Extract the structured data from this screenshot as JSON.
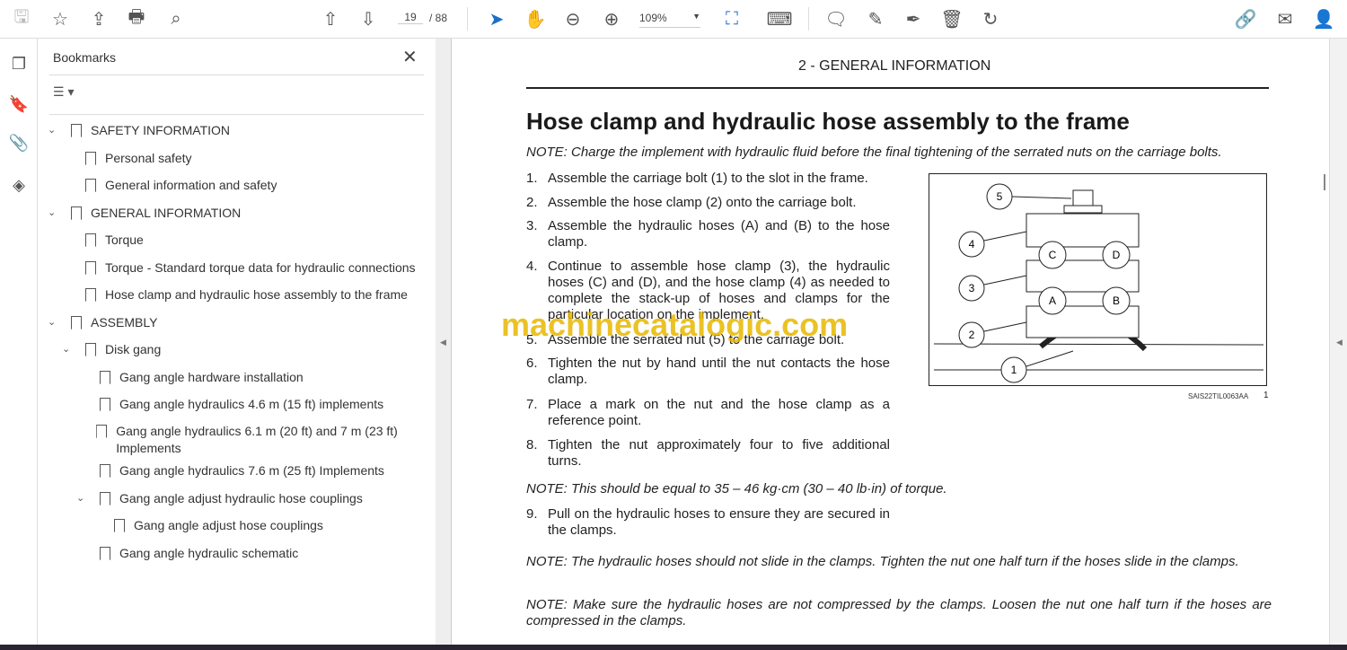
{
  "toolbar": {
    "page_current": "19",
    "page_total": "/ 88",
    "zoom": "109%"
  },
  "sidebar": {
    "title": "Bookmarks",
    "items": [
      {
        "label": "SAFETY INFORMATION",
        "level": 0,
        "expanded": true
      },
      {
        "label": "Personal safety",
        "level": 1
      },
      {
        "label": "General information and safety",
        "level": 1
      },
      {
        "label": "GENERAL INFORMATION",
        "level": 0,
        "expanded": true
      },
      {
        "label": "Torque",
        "level": 1
      },
      {
        "label": "Torque - Standard torque data for hydraulic connections",
        "level": 1
      },
      {
        "label": "Hose clamp and hydraulic hose assembly to the frame",
        "level": 1
      },
      {
        "label": "ASSEMBLY",
        "level": 0,
        "expanded": true
      },
      {
        "label": "Disk gang",
        "level": 1,
        "expanded": true
      },
      {
        "label": "Gang angle hardware installation",
        "level": 2
      },
      {
        "label": "Gang angle hydraulics 4.6 m (15 ft) implements",
        "level": 2
      },
      {
        "label": "Gang angle hydraulics 6.1 m (20 ft) and 7 m (23 ft) Implements",
        "level": 2
      },
      {
        "label": "Gang angle hydraulics 7.6 m (25 ft) Implements",
        "level": 2
      },
      {
        "label": "Gang angle adjust hydraulic hose couplings",
        "level": 2,
        "expanded": true
      },
      {
        "label": "Gang angle adjust hose couplings",
        "level": 3
      },
      {
        "label": "Gang angle hydraulic schematic",
        "level": 2
      }
    ]
  },
  "doc": {
    "header": "2 - GENERAL INFORMATION",
    "title": "Hose clamp and hydraulic hose assembly to the frame",
    "note1": "NOTE: Charge the implement with hydraulic fluid before the final tightening of the serrated nuts on the carriage bolts.",
    "steps": [
      {
        "n": "1.",
        "t": "Assemble the carriage bolt (1) to the slot in the frame."
      },
      {
        "n": "2.",
        "t": "Assemble the hose clamp (2) onto the carriage bolt."
      },
      {
        "n": "3.",
        "t": "Assemble the hydraulic hoses (A) and (B) to the hose clamp."
      },
      {
        "n": "4.",
        "t": "Continue to assemble hose clamp (3), the hydraulic hoses (C) and (D), and the hose clamp (4) as needed to complete the stack-up of hoses and clamps for the particular location on the implement."
      },
      {
        "n": "5.",
        "t": "Assemble the serrated nut (5) to the carriage bolt."
      },
      {
        "n": "6.",
        "t": "Tighten the nut by hand until the nut contacts the hose clamp."
      },
      {
        "n": "7.",
        "t": "Place a mark on the nut and the hose clamp as a reference point."
      },
      {
        "n": "8.",
        "t": "Tighten the nut approximately four to five additional turns."
      }
    ],
    "note2": "NOTE: This should be equal to 35 – 46 kg·cm (30 – 40 lb·in) of torque.",
    "step9": {
      "n": "9.",
      "t": "Pull on the hydraulic hoses to ensure they are secured in the clamps."
    },
    "note3": "NOTE: The hydraulic hoses should not slide in the clamps.  Tighten the nut one half turn if the hoses slide in the clamps.",
    "note4": "NOTE: Make sure the hydraulic hoses are not compressed by the clamps. Loosen the nut one half turn if the hoses are compressed in the clamps.",
    "figure": {
      "id": "SAIS22TIL0063AA",
      "number": "1",
      "callouts": [
        "1",
        "2",
        "3",
        "4",
        "5"
      ],
      "hoses": [
        "A",
        "B",
        "C",
        "D"
      ]
    }
  },
  "watermark": "machinecatalogic.com"
}
